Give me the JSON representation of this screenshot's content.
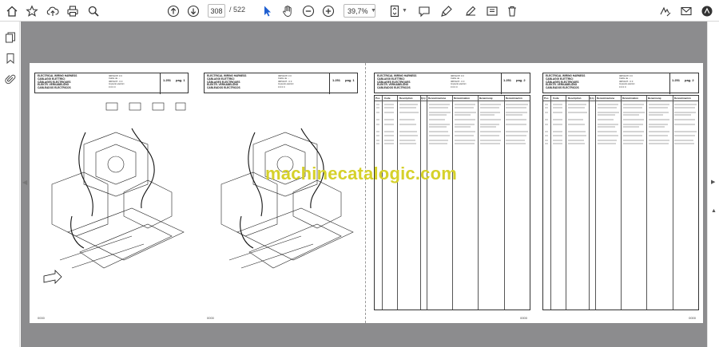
{
  "toolbar": {
    "page_current": "308",
    "page_total": "/ 522",
    "zoom": "39,7%"
  },
  "watermark": "machinecatalogic.com",
  "pages": [
    {
      "title": "ELECTRICAL WIRING HARNESS\nCABLAGGI ELETTRICI\nCÂBLAGES ELECTRIQUES\nELEKTR. VERKABELUNG\nCABLEADOS ELECTRICOS",
      "mid": "IMPIANTI 0 0\nCable de ...\nIMPIANT.. 0 0\nImpianti elettrici\n0 0 0 0",
      "code": "1.251",
      "pag": "pag. 1",
      "number": "0000"
    },
    {
      "title": "ELECTRICAL WIRING HARNESS\nCABLAGGI ELETTRICI\nCÂBLAGES ELECTRIQUES\nELEKTR. VERKABELUNG\nCABLEADOS ELECTRICOS",
      "mid": "IMPIANTI 0 0\nCable de ...\nIMPIANT.. 0 0\nImpianti elettrici\n0 0 0 0",
      "code": "1.251",
      "pag": "pag. 1",
      "number": "0000"
    },
    {
      "title": "ELECTRICAL WIRING HARNESS\nCABLAGGI ELETTRICI\nCÂBLAGES ELECTRIQUES\nELEKTR. VERKABELUNG\nCABLEADOS ELECTRICOS",
      "mid": "IMPIANTI 0 0\nCable de ...\nIMPIANT.. 0 0\nImpianti elettrici\n0 0 0 0",
      "code": "1.251",
      "pag": "pag. 2",
      "number": "0000",
      "headers": [
        "Pos",
        "Code",
        "Description",
        "Q.ty",
        "Denominazione",
        "Dénomination",
        "Benennung",
        "Denominación"
      ]
    },
    {
      "title": "ELECTRICAL WIRING HARNESS\nCABLAGGI ELETTRICI\nCÂBLAGES ELECTRIQUES\nELEKTR. VERKABELUNG\nCABLEADOS ELECTRICOS",
      "mid": "IMPIANTI 0 0\nCable de ...\nIMPIANT.. 0 0\nImpianti elettrici\n0 0 0 0",
      "code": "1.251",
      "pag": "pag. 2",
      "number": "0000",
      "headers": [
        "Pos",
        "Code",
        "Description",
        "Q.ty",
        "Denominazione",
        "Dénomination",
        "Benennung",
        "Denominación"
      ]
    }
  ],
  "icons": {
    "home": "home-icon",
    "star": "star-icon",
    "upload": "upload-icon",
    "print": "print-icon",
    "zoom": "magnifier-icon",
    "up": "arrow-up-icon",
    "down": "arrow-down-icon",
    "cursor": "cursor-icon",
    "hand": "hand-icon",
    "minus": "zoom-out-icon",
    "plus": "zoom-in-icon"
  }
}
